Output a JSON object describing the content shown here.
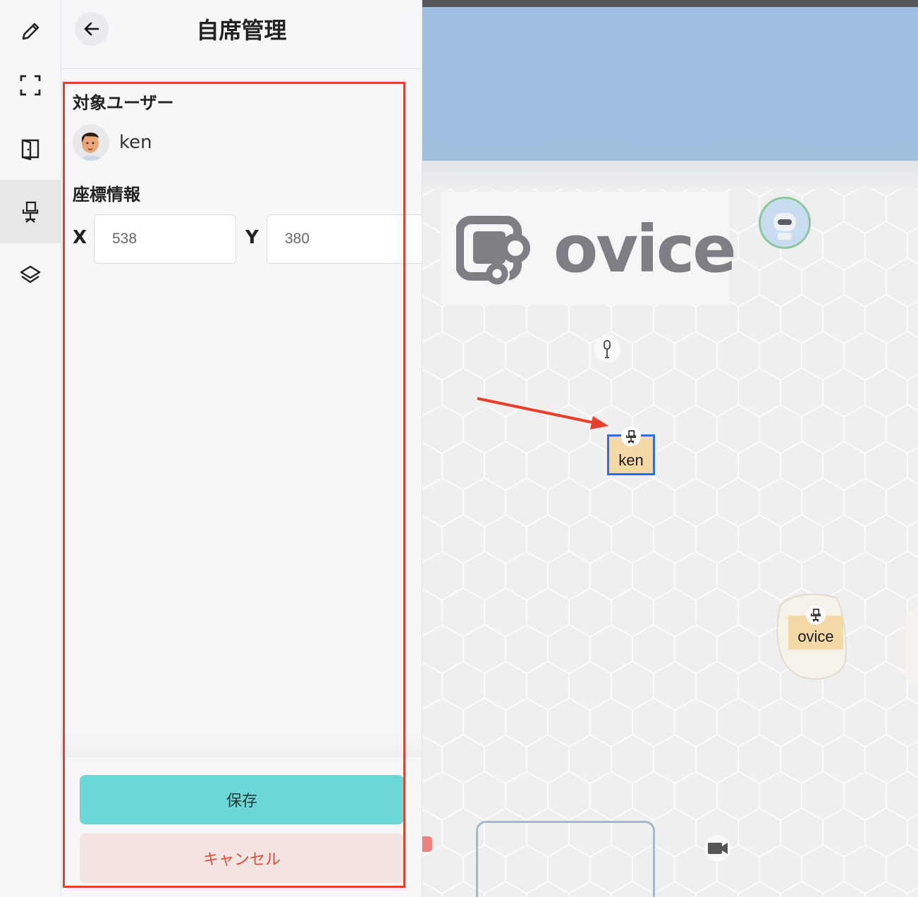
{
  "panel": {
    "title": "自席管理",
    "target_user_label": "対象ユーザー",
    "user_name": "ken",
    "coordinates_label": "座標情報",
    "x_label": "X",
    "y_label": "Y",
    "x_value": "538",
    "y_value": "380",
    "save_label": "保存",
    "cancel_label": "キャンセル"
  },
  "rail": {
    "items": [
      {
        "icon": "pencil-icon"
      },
      {
        "icon": "fullscreen-icon"
      },
      {
        "icon": "door-icon"
      },
      {
        "icon": "desk-chair-icon",
        "active": true
      },
      {
        "icon": "layers-icon"
      }
    ]
  },
  "map": {
    "logo_text": "ovice",
    "seats": [
      {
        "label": "ken",
        "selected": true
      },
      {
        "label": "ovice",
        "selected": false
      }
    ]
  },
  "colors": {
    "save_button": "#6dd6d7",
    "cancel_text": "#e0493b",
    "annotation_red": "#e63f2b",
    "selection_blue": "#2f6de1",
    "seat_fill": "#f4d9a6"
  }
}
